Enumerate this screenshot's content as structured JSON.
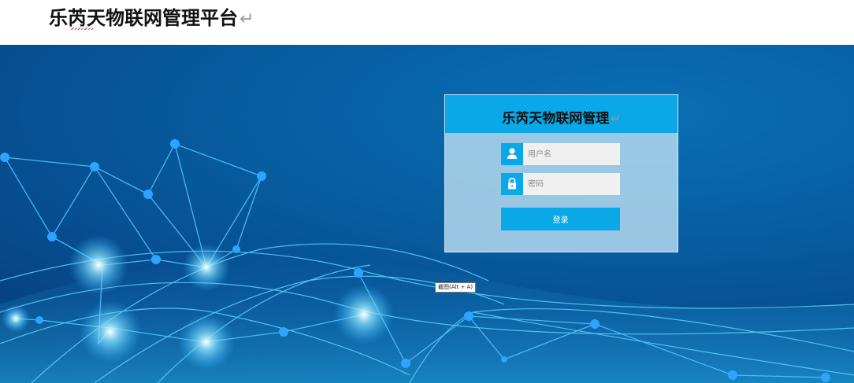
{
  "document": {
    "heading": "乐芮天物联网管理平台",
    "paragraph_mark": "↵"
  },
  "login": {
    "title": "乐芮天物联网管理",
    "title_paragraph_mark": "↵",
    "username_placeholder": "用户名",
    "password_placeholder": "密码",
    "submit_label": "登录",
    "icons": {
      "username": "user-icon",
      "password": "lock-icon"
    }
  },
  "tooltip": {
    "text": "截图(Alt + A)"
  },
  "colors": {
    "accent": "#0aa8e6",
    "background_dark": "#043a74",
    "background_mid": "#075c9f",
    "input_bg": "#f0f0f0"
  }
}
